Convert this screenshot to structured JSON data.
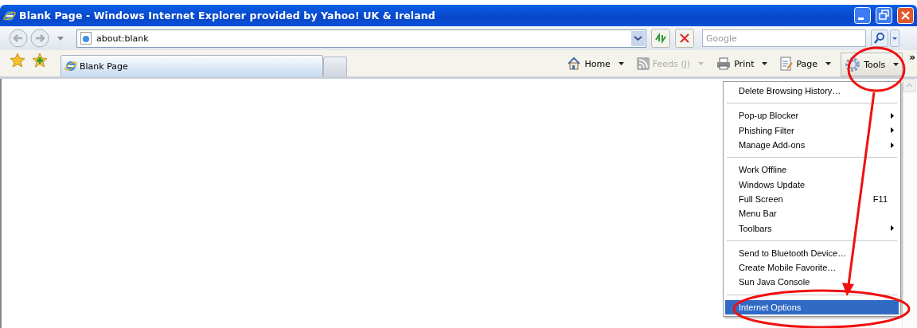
{
  "window": {
    "title": "Blank Page - Windows Internet Explorer provided by Yahoo! UK & Ireland"
  },
  "address_bar": {
    "value": "about:blank"
  },
  "search": {
    "placeholder": "Google"
  },
  "tabs": [
    {
      "label": "Blank Page",
      "selected": true
    }
  ],
  "command_bar": [
    {
      "label": "Home",
      "disabled": false,
      "pressed": false
    },
    {
      "label": "Feeds (J)",
      "disabled": true,
      "pressed": false
    },
    {
      "label": "Print",
      "disabled": false,
      "pressed": false
    },
    {
      "label": "Page",
      "disabled": false,
      "pressed": false
    },
    {
      "label": "Tools",
      "disabled": false,
      "pressed": true
    }
  ],
  "overflow": "»",
  "tools_menu": {
    "groups": [
      [
        {
          "label": "Delete Browsing History…",
          "submenu": false,
          "selected": false
        }
      ],
      [
        {
          "label": "Pop-up Blocker",
          "submenu": true,
          "selected": false
        },
        {
          "label": "Phishing Filter",
          "submenu": true,
          "selected": false
        },
        {
          "label": "Manage Add-ons",
          "submenu": true,
          "selected": false
        }
      ],
      [
        {
          "label": "Work Offline",
          "submenu": false,
          "selected": false
        },
        {
          "label": "Windows Update",
          "submenu": false,
          "selected": false
        },
        {
          "label": "Full Screen",
          "shortcut": "F11",
          "submenu": false,
          "selected": false
        },
        {
          "label": "Menu Bar",
          "submenu": false,
          "selected": false
        },
        {
          "label": "Toolbars",
          "submenu": true,
          "selected": false
        }
      ],
      [
        {
          "label": "Send to Bluetooth Device…",
          "submenu": false,
          "selected": false
        },
        {
          "label": "Create Mobile Favorite…",
          "submenu": false,
          "selected": false
        },
        {
          "label": "Sun Java Console",
          "submenu": false,
          "selected": false
        }
      ],
      [
        {
          "label": "Internet Options",
          "submenu": false,
          "selected": true
        }
      ]
    ]
  }
}
